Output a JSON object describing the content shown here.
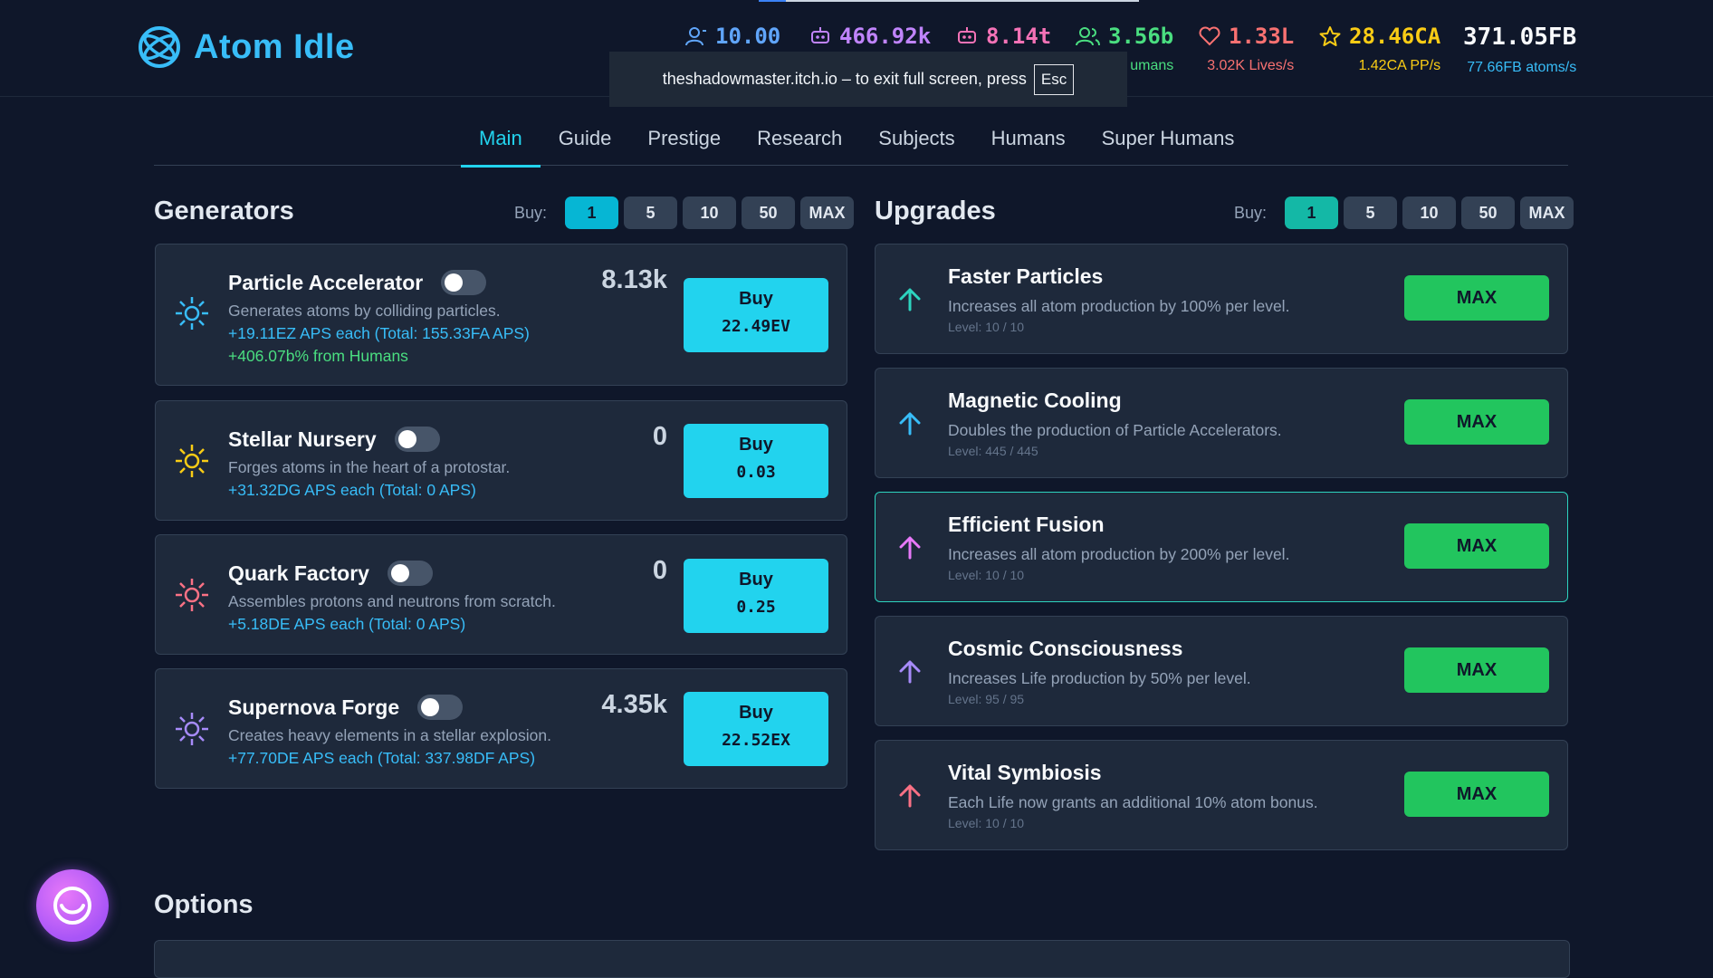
{
  "app": {
    "title": "Atom Idle"
  },
  "stats": {
    "subjects": {
      "value": "10.00",
      "color": "#60a5fa"
    },
    "robots_a": {
      "value": "466.92k",
      "color": "#c084fc"
    },
    "robots_b": {
      "value": "8.14t",
      "color": "#f472b6"
    },
    "humans": {
      "value": "3.56b",
      "sub": "umans",
      "color": "#4ade80"
    },
    "lives": {
      "value": "1.33L",
      "sub": "3.02K Lives/s",
      "color": "#f87171"
    },
    "prestige": {
      "value": "28.46CA",
      "sub": "1.42CA PP/s",
      "color": "#facc15"
    },
    "atoms": {
      "value": "371.05FB",
      "sub": "77.66FB atoms/s",
      "color": "#f8fafc",
      "sub_color": "#38bdf8"
    }
  },
  "toast": {
    "text": "theshadowmaster.itch.io – to exit full screen, press",
    "key": "Esc"
  },
  "tabs": [
    "Main",
    "Guide",
    "Prestige",
    "Research",
    "Subjects",
    "Humans",
    "Super Humans"
  ],
  "generators": {
    "title": "Generators",
    "buy_label": "Buy:",
    "quantities": [
      "1",
      "5",
      "10",
      "50",
      "MAX"
    ],
    "items": [
      {
        "name": "Particle Accelerator",
        "desc": "Generates atoms by colliding particles.",
        "aps": "+19.11EZ APS each (Total: 155.33FA APS)",
        "humans": "+406.07b% from Humans",
        "count": "8.13k",
        "buy": "Buy",
        "cost": "22.49EV",
        "icon_color": "#38bdf8"
      },
      {
        "name": "Stellar Nursery",
        "desc": "Forges atoms in the heart of a protostar.",
        "aps": "+31.32DG APS each (Total: 0 APS)",
        "count": "0",
        "buy": "Buy",
        "cost": "0.03",
        "icon_color": "#facc15"
      },
      {
        "name": "Quark Factory",
        "desc": "Assembles protons and neutrons from scratch.",
        "aps": "+5.18DE APS each (Total: 0 APS)",
        "count": "0",
        "buy": "Buy",
        "cost": "0.25",
        "icon_color": "#fb7185"
      },
      {
        "name": "Supernova Forge",
        "desc": "Creates heavy elements in a stellar explosion.",
        "aps": "+77.70DE APS each (Total: 337.98DF APS)",
        "count": "4.35k",
        "buy": "Buy",
        "cost": "22.52EX",
        "icon_color": "#a78bfa"
      }
    ]
  },
  "upgrades": {
    "title": "Upgrades",
    "buy_label": "Buy:",
    "quantities": [
      "1",
      "5",
      "10",
      "50",
      "MAX"
    ],
    "items": [
      {
        "name": "Faster Particles",
        "desc": "Increases all atom production by 100% per level.",
        "level": "Level: 10 / 10",
        "button": "MAX",
        "icon_color": "#2dd4bf"
      },
      {
        "name": "Magnetic Cooling",
        "desc": "Doubles the production of Particle Accelerators.",
        "level": "Level: 445 / 445",
        "button": "MAX",
        "icon_color": "#38bdf8"
      },
      {
        "name": "Efficient Fusion",
        "desc": "Increases all atom production by 200% per level.",
        "level": "Level: 10 / 10",
        "button": "MAX",
        "icon_color": "#e879f9"
      },
      {
        "name": "Cosmic Consciousness",
        "desc": "Increases Life production by 50% per level.",
        "level": "Level: 95 / 95",
        "button": "MAX",
        "icon_color": "#a78bfa"
      },
      {
        "name": "Vital Symbiosis",
        "desc": "Each Life now grants an additional 10% atom bonus.",
        "level": "Level: 10 / 10",
        "button": "MAX",
        "icon_color": "#fb7185"
      }
    ]
  },
  "options": {
    "title": "Options"
  }
}
